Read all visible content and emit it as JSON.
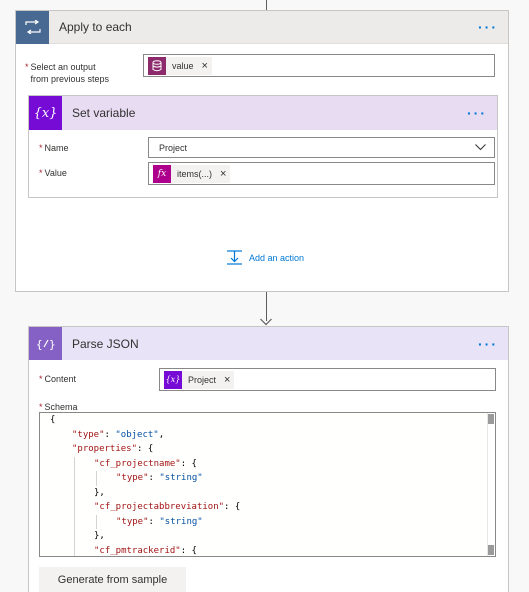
{
  "apply_to_each": {
    "title": "Apply to each",
    "select_label_line1": "Select an output",
    "select_label_line2": "from previous steps",
    "token_label": "value"
  },
  "set_variable": {
    "title": "Set variable",
    "name_label": "Name",
    "name_value": "Project",
    "value_label": "Value",
    "value_token": "items(...)"
  },
  "add_action": {
    "label": "Add an action"
  },
  "parse_json": {
    "title": "Parse JSON",
    "content_label": "Content",
    "content_token": "Project",
    "schema_label": "Schema",
    "schema_lines": [
      {
        "indent": 0,
        "parts": [
          [
            "p",
            "{"
          ]
        ]
      },
      {
        "indent": 1,
        "parts": [
          [
            "k",
            "\"type\""
          ],
          [
            "p",
            ": "
          ],
          [
            "s",
            "\"object\""
          ],
          [
            "p",
            ","
          ]
        ]
      },
      {
        "indent": 1,
        "parts": [
          [
            "k",
            "\"properties\""
          ],
          [
            "p",
            ": {"
          ]
        ]
      },
      {
        "indent": 2,
        "parts": [
          [
            "k",
            "\"cf_projectname\""
          ],
          [
            "p",
            ": {"
          ]
        ]
      },
      {
        "indent": 3,
        "parts": [
          [
            "k",
            "\"type\""
          ],
          [
            "p",
            ": "
          ],
          [
            "s",
            "\"string\""
          ]
        ]
      },
      {
        "indent": 2,
        "parts": [
          [
            "p",
            "},"
          ]
        ]
      },
      {
        "indent": 2,
        "parts": [
          [
            "k",
            "\"cf_projectabbreviation\""
          ],
          [
            "p",
            ": {"
          ]
        ]
      },
      {
        "indent": 3,
        "parts": [
          [
            "k",
            "\"type\""
          ],
          [
            "p",
            ": "
          ],
          [
            "s",
            "\"string\""
          ]
        ]
      },
      {
        "indent": 2,
        "parts": [
          [
            "p",
            "},"
          ]
        ]
      },
      {
        "indent": 2,
        "parts": [
          [
            "k",
            "\"cf_pmtrackerid\""
          ],
          [
            "p",
            ": {"
          ]
        ]
      }
    ],
    "generate_button": "Generate from sample"
  },
  "colors": {
    "loop_icon": "#486991",
    "variable_icon": "#770bd6",
    "parse_icon": "#8661c5",
    "link": "#0078d4",
    "required": "#a4262c"
  },
  "icons": {
    "apply_header": "loop-icon",
    "value_token": "database-icon",
    "variable_header": "variable-icon",
    "items_token": "function-icon",
    "add_action": "add-action-icon",
    "parse_header": "parse-json-icon",
    "project_token": "variable-icon",
    "more": "ellipsis-icon",
    "dropdown": "chevron-down-icon"
  },
  "more_dots": "···",
  "required_mark": "*"
}
